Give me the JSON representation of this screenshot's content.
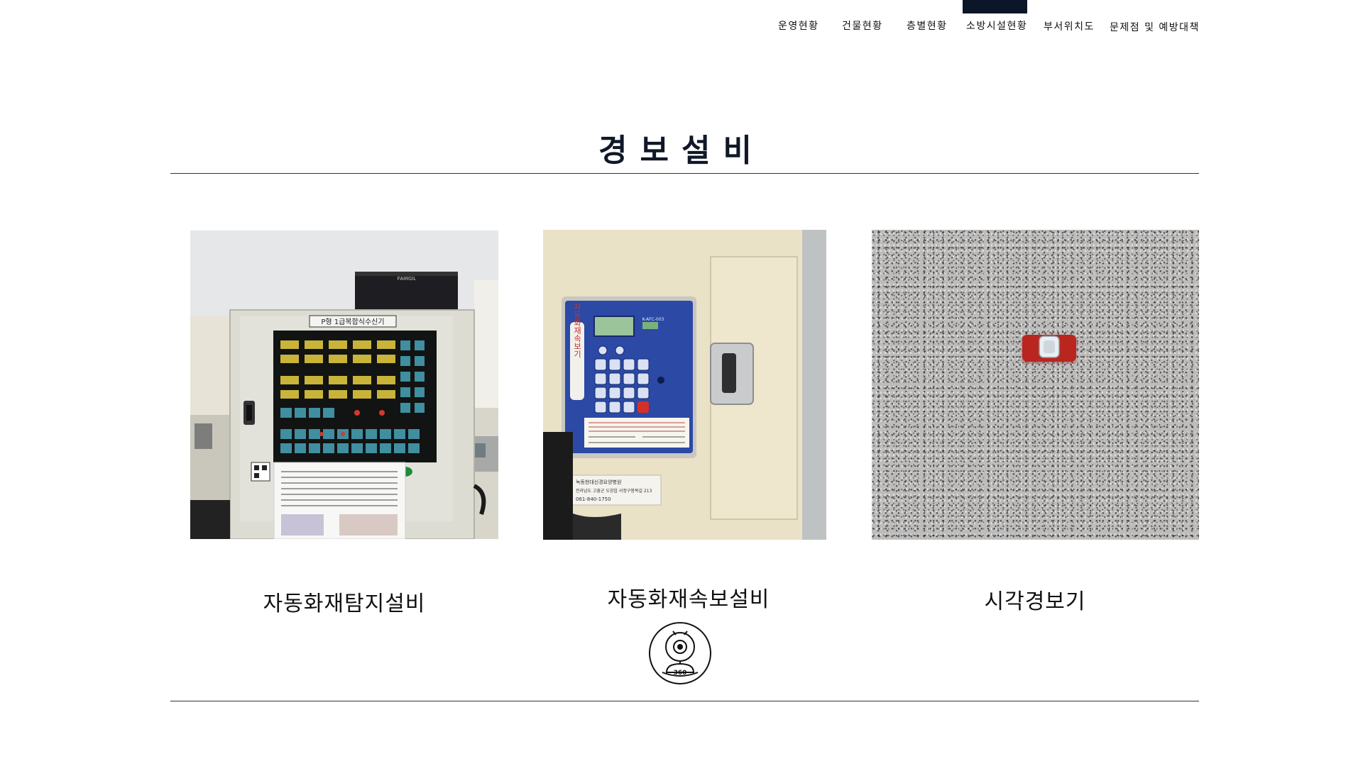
{
  "nav": {
    "items": [
      {
        "label": "운영현황"
      },
      {
        "label": "건물현황"
      },
      {
        "label": "층별현황"
      },
      {
        "label": "소방시설현황",
        "active": true
      },
      {
        "label": "부서위치도"
      },
      {
        "label": "문제점 및 예방대책"
      }
    ],
    "active_color": "#0b1628"
  },
  "section": {
    "title": "경보설비"
  },
  "cards": [
    {
      "caption": "자동화재탐지설비",
      "photo": {
        "panel_label": "P형 1급복합식수신기",
        "brand": "FAIRGIL"
      }
    },
    {
      "caption": "자동화재속보설비",
      "photo": {
        "device_label": "자동화재속보기",
        "model": "K-AFC-003",
        "sticker_lines": [
          "녹동현대신경요양병원",
          "전라남도 고흥군 도양읍 서정구봉목길 213",
          "061-840-1750"
        ]
      }
    },
    {
      "caption": "시각경보기",
      "photo": {}
    }
  ],
  "icons": {
    "view360": "360-camera-icon",
    "view360_text": "360"
  },
  "colors": {
    "accent": "#0b1628",
    "rule": "#333333",
    "text": "#111111"
  }
}
